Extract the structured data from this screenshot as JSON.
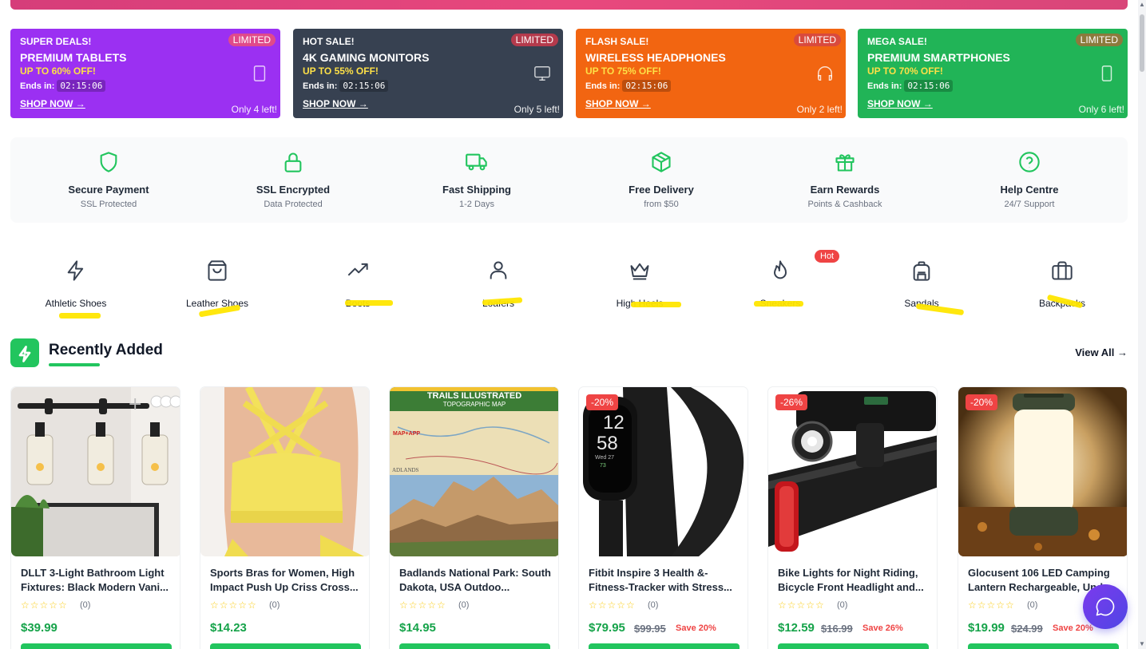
{
  "deals": [
    {
      "kicker": "SUPER DEALS!",
      "title": "PREMIUM TABLETS",
      "off": "UP TO 60% OFF!",
      "ends_label": "Ends in:",
      "timer": "02:15:06",
      "shop": "SHOP NOW →",
      "badge": "LIMITED",
      "stock": "Only 4 left!",
      "icon": "tablet-icon",
      "bg": "#9b30f2",
      "badge_bg": "#e04a8a"
    },
    {
      "kicker": "HOT SALE!",
      "title": "4K GAMING MONITORS",
      "off": "UP TO 55% OFF!",
      "ends_label": "Ends in:",
      "timer": "02:15:06",
      "shop": "SHOP NOW →",
      "badge": "LIMITED",
      "stock": "Only 5 left!",
      "icon": "monitor-icon",
      "bg": "#374151",
      "badge_bg": "#b43a4c"
    },
    {
      "kicker": "FLASH SALE!",
      "title": "WIRELESS HEADPHONES",
      "off": "UP TO 75% OFF!",
      "ends_label": "Ends in:",
      "timer": "02:15:06",
      "shop": "SHOP NOW →",
      "badge": "LIMITED",
      "stock": "Only 2 left!",
      "icon": "headphones-icon",
      "bg": "#f26511",
      "badge_bg": "#d94a3d"
    },
    {
      "kicker": "MEGA SALE!",
      "title": "PREMIUM SMARTPHONES",
      "off": "UP TO 70% OFF!",
      "ends_label": "Ends in:",
      "timer": "02:15:06",
      "shop": "SHOP NOW →",
      "badge": "LIMITED",
      "stock": "Only 6 left!",
      "icon": "smartphone-icon",
      "bg": "#21b457",
      "badge_bg": "#8c7a3c"
    }
  ],
  "features": [
    {
      "name": "Secure Payment",
      "sub": "SSL Protected",
      "icon": "shield-icon"
    },
    {
      "name": "SSL Encrypted",
      "sub": "Data Protected",
      "icon": "lock-icon"
    },
    {
      "name": "Fast Shipping",
      "sub": "1-2 Days",
      "icon": "truck-icon"
    },
    {
      "name": "Free Delivery",
      "sub": "from $50",
      "icon": "package-icon"
    },
    {
      "name": "Earn Rewards",
      "sub": "Points & Cashback",
      "icon": "gift-icon"
    },
    {
      "name": "Help Centre",
      "sub": "24/7 Support",
      "icon": "help-circle-icon"
    }
  ],
  "categories": [
    {
      "label": "Athletic Shoes",
      "icon": "lightning-icon"
    },
    {
      "label": "Leather Shoes",
      "icon": "shopping-bag-icon"
    },
    {
      "label": "Boots",
      "icon": "trending-up-icon"
    },
    {
      "label": "Loafers",
      "icon": "user-icon"
    },
    {
      "label": "High Heels",
      "icon": "crown-icon"
    },
    {
      "label": "Sneakers",
      "icon": "flame-icon"
    },
    {
      "label": "Sandals",
      "icon": "backpack-icon"
    },
    {
      "label": "Backpacks",
      "icon": "briefcase-icon"
    }
  ],
  "hot_badge": "Hot",
  "section": {
    "title": "Recently Added",
    "view_all": "View All →"
  },
  "products": [
    {
      "name": "DLLT 3-Light Bathroom Light Fixtures: Black Modern Vani...",
      "stars": "☆☆☆☆☆",
      "reviews": "(0)",
      "price": "$39.99",
      "old": "",
      "save": "",
      "discount": ""
    },
    {
      "name": "Sports Bras for Women, High Impact Push Up Criss Cross...",
      "stars": "☆☆☆☆☆",
      "reviews": "(0)",
      "price": "$14.23",
      "old": "",
      "save": "",
      "discount": ""
    },
    {
      "name": "Badlands National Park: South Dakota, USA Outdoo...",
      "stars": "☆☆☆☆☆",
      "reviews": "(0)",
      "price": "$14.95",
      "old": "",
      "save": "",
      "discount": ""
    },
    {
      "name": "Fitbit Inspire 3 Health &-Fitness-Tracker with Stress...",
      "stars": "☆☆☆☆☆",
      "reviews": "(0)",
      "price": "$79.95",
      "old": "$99.95",
      "save": "Save 20%",
      "discount": "-20%"
    },
    {
      "name": "Bike Lights for Night Riding, Bicycle Front Headlight and...",
      "stars": "☆☆☆☆☆",
      "reviews": "(0)",
      "price": "$12.59",
      "old": "$16.99",
      "save": "Save 26%",
      "discount": "-26%"
    },
    {
      "name": "Glocusent 106 LED Camping Lantern Rechargeable, Und...",
      "stars": "☆☆☆☆☆",
      "reviews": "(0)",
      "price": "$19.99",
      "old": "$24.99",
      "save": "Save 20%",
      "discount": "-20%"
    }
  ],
  "map_text": {
    "banner": "TRAILS ILLUSTRATED",
    "sub": "TOPOGRAPHIC MAP",
    "app": "MAP+APP",
    "region": "ADLANDS"
  },
  "fitbit_text": {
    "time_h": "12",
    "time_m": "58",
    "date": "Wed 27",
    "hr": "73"
  },
  "colors": {
    "accent": "#22c55e",
    "sale": "#ef4444",
    "chat": "#5b3df0",
    "highlight": "#ffe600"
  }
}
